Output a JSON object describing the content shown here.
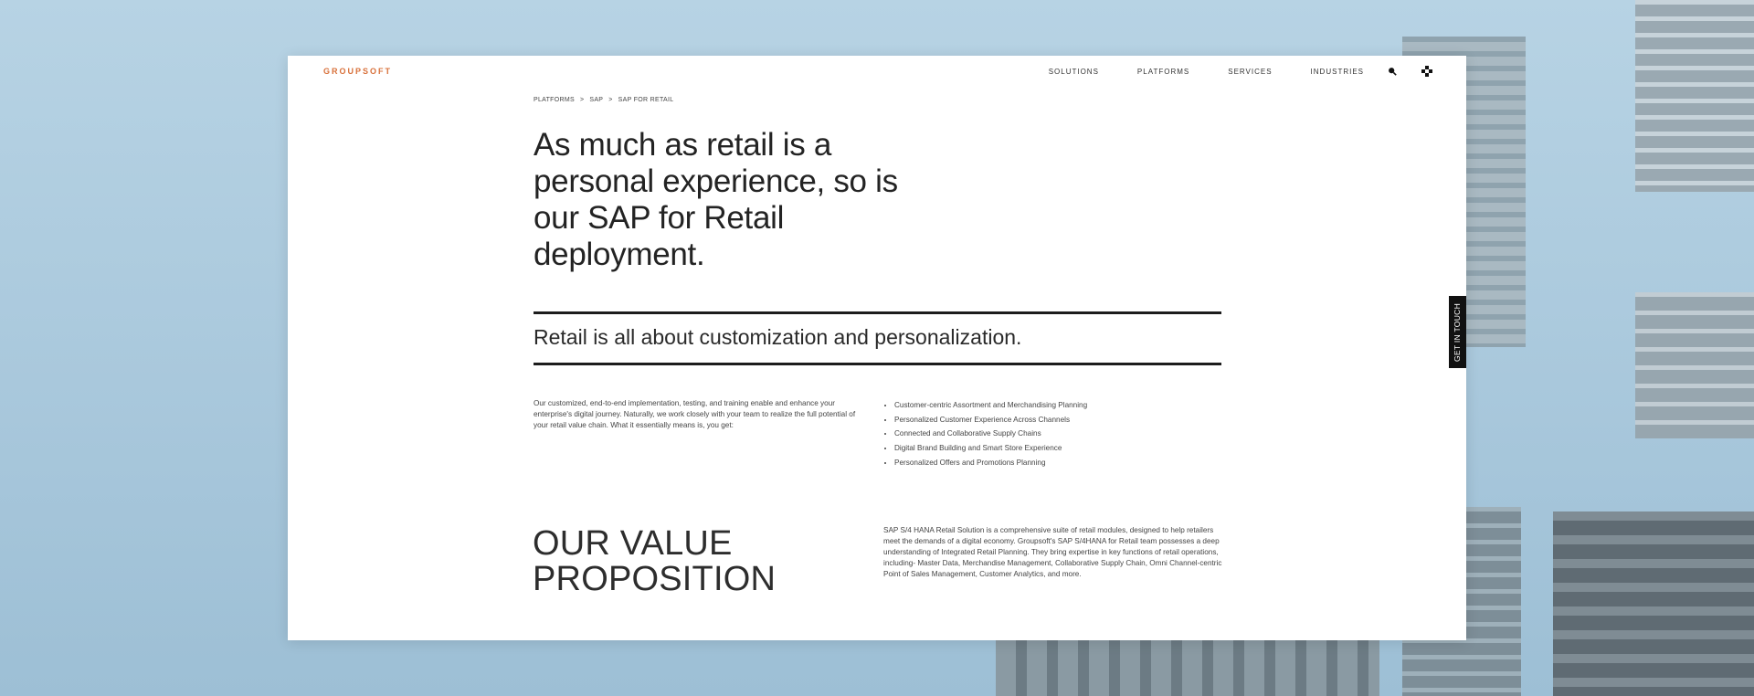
{
  "logo": "GROUPSOFT",
  "nav": {
    "items": [
      "SOLUTIONS",
      "PLATFORMS",
      "SERVICES",
      "INDUSTRIES"
    ],
    "search_icon": "search-icon",
    "menu_icon": "grid-menu-icon"
  },
  "breadcrumb": [
    "PLATFORMS",
    "SAP",
    "SAP FOR RETAIL"
  ],
  "breadcrumb_sep": ">",
  "hero": {
    "title": "As much as retail is a personal experience, so is our SAP for Retail deployment."
  },
  "subheading": "Retail is all about customization and personalization.",
  "intro": "Our customized, end-to-end implementation, testing, and training enable and enhance your enterprise's digital journey. Naturally, we work closely with your team to realize the full potential of your retail value chain. What it essentially means is, you get:",
  "benefits": [
    "Customer-centric Assortment and Merchandising Planning",
    "Personalized Customer Experience Across Channels",
    "Connected and Collaborative Supply Chains",
    "Digital Brand Building and Smart Store Experience",
    "Personalized Offers and Promotions Planning"
  ],
  "value": {
    "title_line1": "OUR VALUE",
    "title_line2": "PROPOSITION",
    "text": "SAP S/4 HANA Retail Solution is a comprehensive suite of retail modules, designed to help retailers meet the demands of a digital economy. Groupsoft's SAP S/4HANA for Retail team possesses a deep understanding of Integrated Retail Planning. They bring expertise in key functions of retail operations, including- Master Data, Merchandise Management, Collaborative Supply Chain, Omni Channel-centric Point of Sales Management, Customer Analytics, and more."
  },
  "cta": "GET IN TOUCH",
  "colors": {
    "brand": "#d8703a",
    "text": "#232323",
    "cta_bg": "#111111"
  }
}
